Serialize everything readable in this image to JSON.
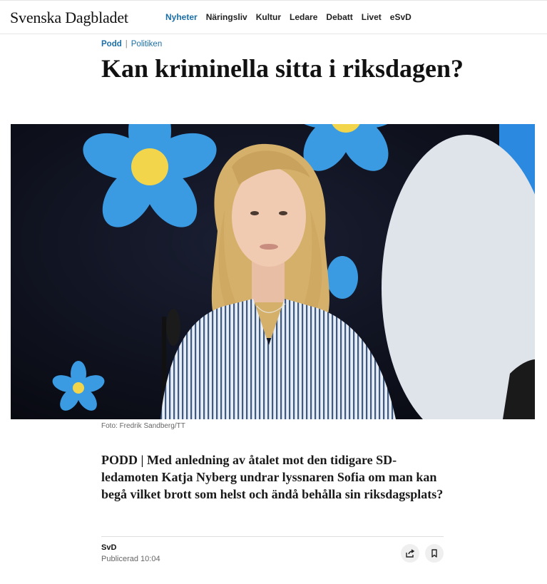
{
  "header": {
    "logo": "Svenska Dagbladet",
    "nav": [
      {
        "label": "Nyheter",
        "active": true
      },
      {
        "label": "Näringsliv",
        "active": false
      },
      {
        "label": "Kultur",
        "active": false
      },
      {
        "label": "Ledare",
        "active": false
      },
      {
        "label": "Debatt",
        "active": false
      },
      {
        "label": "Livet",
        "active": false
      },
      {
        "label": "eSvD",
        "active": false
      }
    ]
  },
  "article": {
    "kicker": "Podd",
    "kicker_separator": "|",
    "section": "Politiken",
    "headline": "Kan kriminella sitta i riksdagen?",
    "photo_caption": "Foto: Fredrik Sandberg/TT",
    "lead": "PODD | Med anledning av åtalet mot den tidigare SD-ledamoten Katja Nyberg undrar lyssnaren Sofia om man kan begå vilket brott som helst och ändå behålla sin riksdagsplats?",
    "author": "SvD",
    "published": "Publicerad 10:04"
  },
  "icons": {
    "share": "share-icon",
    "bookmark": "bookmark-icon"
  },
  "colors": {
    "accent": "#1a6fa8",
    "text": "#1a1a1a",
    "muted": "#666666"
  }
}
